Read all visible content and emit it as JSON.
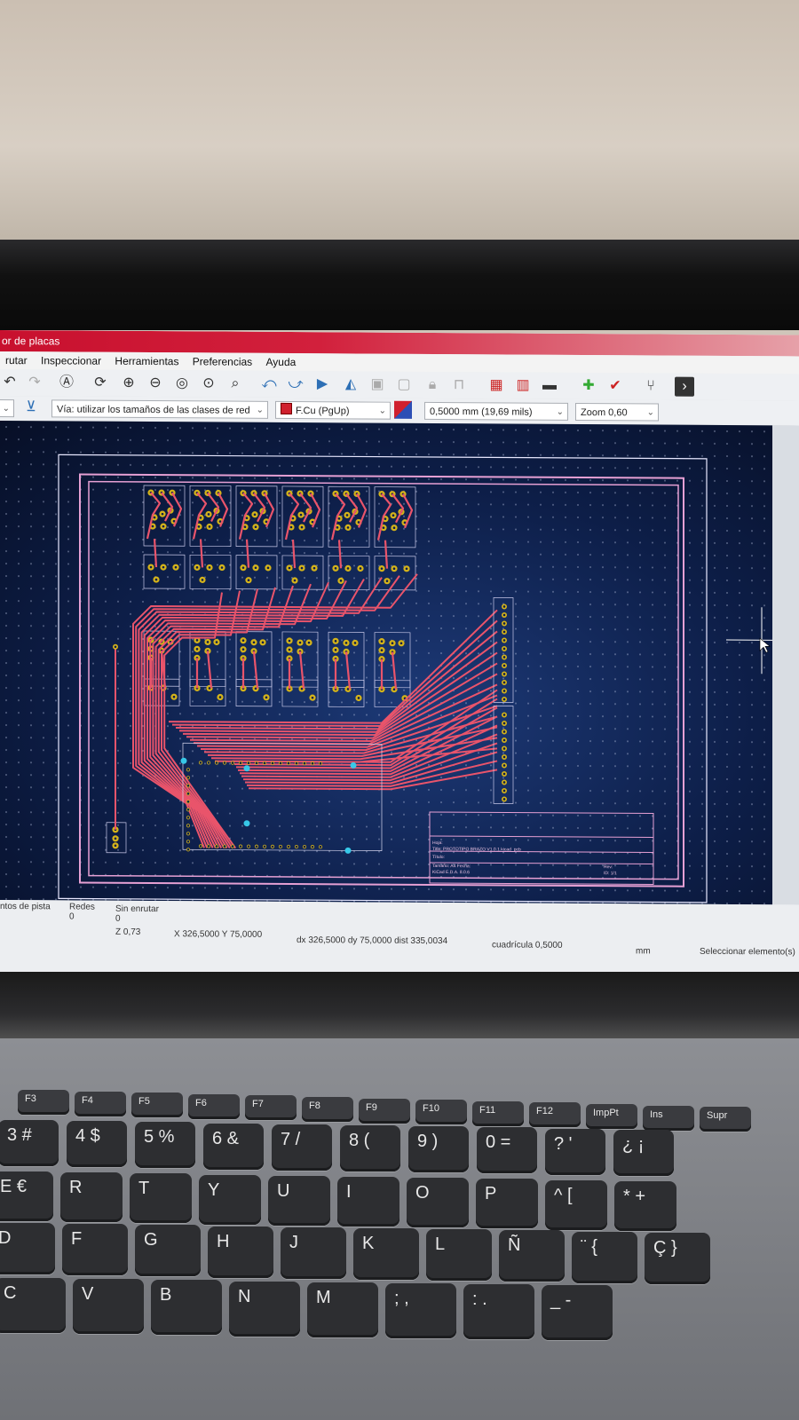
{
  "window": {
    "title": "or de placas"
  },
  "menu": [
    "rutar",
    "Inspeccionar",
    "Herramientas",
    "Preferencias",
    "Ayuda"
  ],
  "toolbar": {
    "icons": [
      "undo-icon",
      "redo-icon",
      "search-text-icon",
      "refresh-icon",
      "zoom-in-icon",
      "zoom-out-icon",
      "zoom-fit-icon",
      "zoom-objects-icon",
      "zoom-select-icon",
      "rotate-ccw-icon",
      "rotate-cw-icon",
      "flip-icon",
      "mirror-icon",
      "group-icon",
      "ungroup-icon",
      "lock-icon",
      "unlock-icon",
      "netlist-icon",
      "footprint-lib-icon",
      "board-setup-icon",
      "drc-icon",
      "drc-check-icon",
      "scripting-icon",
      "terminal-icon"
    ]
  },
  "toolbar2": {
    "via_mode": "Vía: utilizar los tamaños de las clases de red",
    "layer": "F.Cu (PgUp)",
    "layer_color": "#d0202e",
    "grid": "0,5000 mm (19,69 mils)",
    "zoom": "Zoom 0,60"
  },
  "pcb": {
    "title_block_lines": [
      "Hoja:",
      "Title: PROTOTIPO BRAZO V1.0.1.kicad_pcb",
      "Título:",
      "Tamaño: A4    Fecha:",
      "KiCad E.D.A. 8.0.6",
      "Rev:",
      "ID: 1/1"
    ],
    "trace_color": "#e9546b",
    "pad_color": "#d4b31a",
    "edge_color": "#e6a0d4"
  },
  "status": {
    "pads_label": "ntos de pista",
    "nets_label": "Redes",
    "nets_value": "0",
    "unrouted_label": "Sin enrutar",
    "unrouted_value": "0",
    "z": "Z 0,73",
    "xy": "X 326,5000  Y 75,0000",
    "dxdy": "dx 326,5000  dy 75,0000  dist 335,0034",
    "grid": "cuadrícula 0,5000",
    "units": "mm",
    "mode": "Seleccionar elemento(s)"
  },
  "keyboard": {
    "fn_row": [
      "F3",
      "F4",
      "F5",
      "F6",
      "F7",
      "F8",
      "F9",
      "F10",
      "F11",
      "F12",
      "ImpPt",
      "Ins",
      "Supr"
    ],
    "num_row": [
      "3 #",
      "4 $",
      "5 %",
      "6 &",
      "7 /",
      "8 (",
      "9 )",
      "0 =",
      "? '",
      "¿ ¡"
    ],
    "top_row": [
      "E €",
      "R",
      "T",
      "Y",
      "U",
      "I",
      "O",
      "P",
      "^ [",
      "* +"
    ],
    "home_row": [
      "D",
      "F",
      "G",
      "H",
      "J",
      "K",
      "L",
      "Ñ",
      "¨ {",
      "Ç }"
    ],
    "bottom_row": [
      "C",
      "V",
      "B",
      "N",
      "M",
      "; ,",
      ": .",
      "_ -"
    ]
  }
}
